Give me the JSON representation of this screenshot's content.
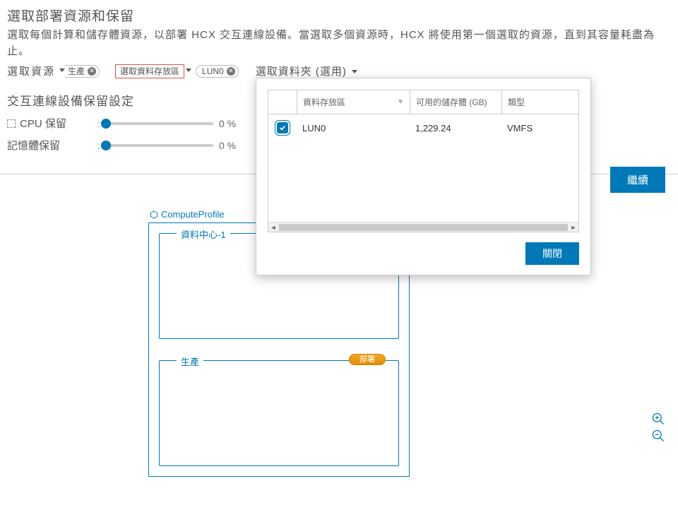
{
  "header": {
    "title": "選取部署資源和保留",
    "description": "選取每個計算和儲存體資源，以部署 HCX 交互連線設備。當選取多個資源時，HCX 將使用第一個選取的資源，直到其容量耗盡為止。",
    "select_resource_label": "選取資源",
    "resource_chip": "生產",
    "datastore_button_label": "選取資料存放區",
    "datastore_chip": "LUN0",
    "select_folder_label": "選取資料夾 (選用)"
  },
  "reservation": {
    "section_title": "交互連線設備保留設定",
    "cpu_label": "CPU 保留",
    "cpu_value": "0 %",
    "mem_label": "記憶體保留",
    "mem_value": "0 %"
  },
  "actions": {
    "continue": "繼續",
    "close": "關閉"
  },
  "diagram": {
    "profile_label": "ComputeProfile",
    "box1_label": "資料中心-1",
    "box2_label": "生產",
    "box2_badge": "部署"
  },
  "popup": {
    "columns": {
      "datastore": "資料存放區",
      "free": "可用的儲存體 (GB)",
      "type": "類型"
    },
    "rows": [
      {
        "checked": true,
        "name": "LUN0",
        "free": "1,229.24",
        "type": "VMFS"
      }
    ]
  }
}
